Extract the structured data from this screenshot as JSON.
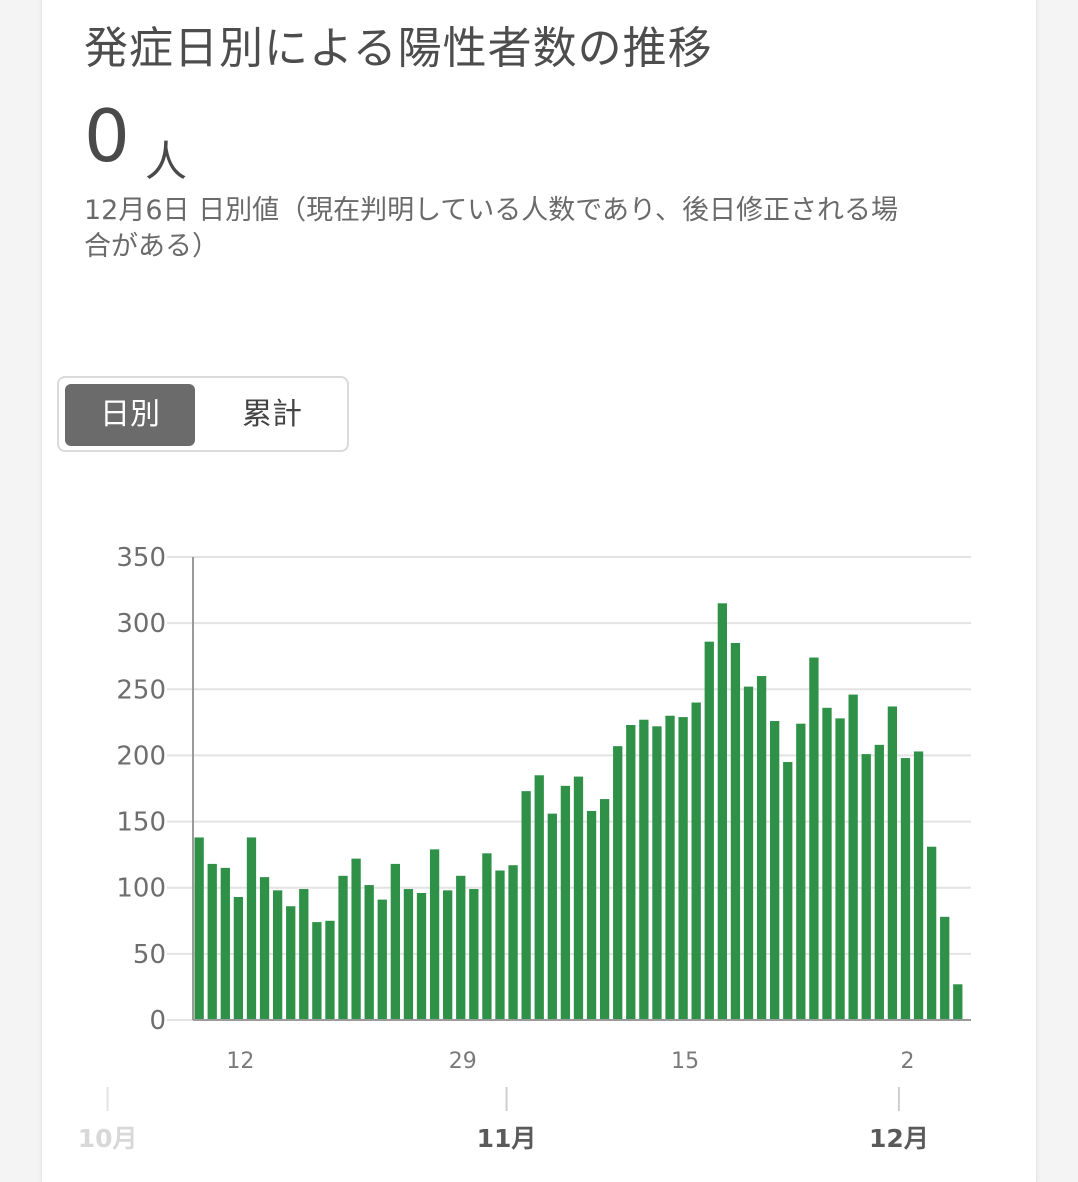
{
  "card": {
    "title": "発症日別による陽性者数の推移",
    "value": "0",
    "unit": "人",
    "subtitle": "12月6日 日別値（現在判明している人数であり、後日修正される場合がある）"
  },
  "toggle": {
    "daily_label": "日別",
    "cumulative_label": "累計",
    "selected": "日別"
  },
  "colors": {
    "bar": "#2e9147",
    "grid": "#e3e3e3",
    "axis": "#9a9a9a",
    "toggle_active": "#6b6b6b"
  },
  "chart_data": {
    "type": "bar",
    "ylim": [
      0,
      350
    ],
    "yticks": [
      "0",
      "50",
      "100",
      "150",
      "200",
      "250",
      "300",
      "350"
    ],
    "xtick_labels": [
      {
        "index": 3,
        "label": "12"
      },
      {
        "index": 20,
        "label": "29"
      },
      {
        "index": 37,
        "label": "15"
      },
      {
        "index": 54,
        "label": "2"
      }
    ],
    "month_labels": [
      {
        "index": -7,
        "label": "10月"
      },
      {
        "index": 23.5,
        "label": "11月"
      },
      {
        "index": 53.5,
        "label": "12月"
      }
    ],
    "grid": true,
    "values": [
      138,
      118,
      115,
      93,
      138,
      108,
      98,
      86,
      99,
      74,
      75,
      109,
      122,
      102,
      91,
      118,
      99,
      96,
      129,
      98,
      109,
      99,
      126,
      113,
      117,
      173,
      185,
      156,
      177,
      184,
      158,
      167,
      207,
      223,
      227,
      222,
      230,
      229,
      240,
      286,
      315,
      285,
      252,
      260,
      226,
      195,
      224,
      274,
      236,
      228,
      246,
      201,
      208,
      237,
      198,
      203,
      131,
      78,
      27
    ]
  }
}
